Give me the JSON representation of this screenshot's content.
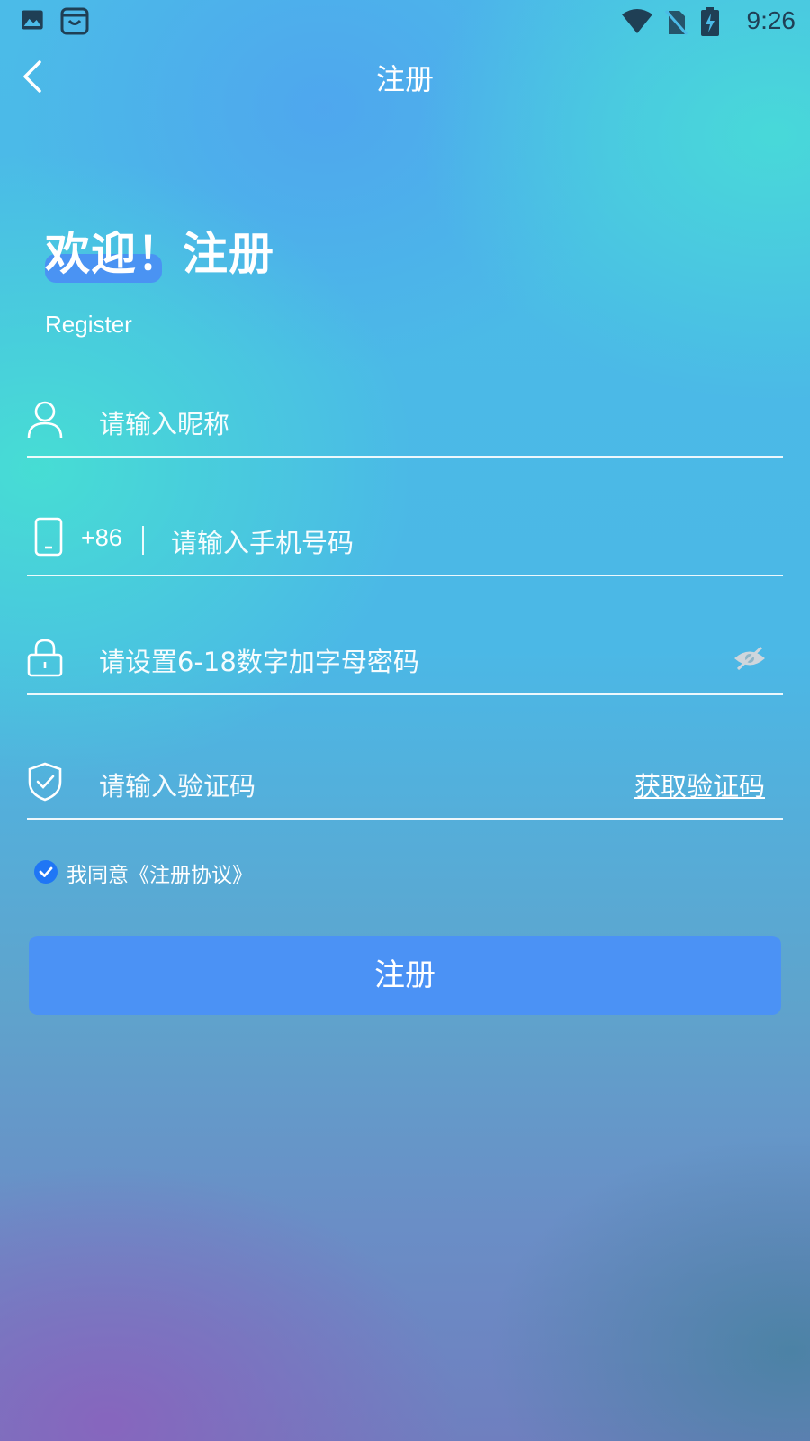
{
  "status_bar": {
    "time": "9:26"
  },
  "header": {
    "title": "注册"
  },
  "hero": {
    "title": "欢迎！注册",
    "subtitle": "Register"
  },
  "form": {
    "nickname_placeholder": "请输入昵称",
    "phone_prefix": "+86",
    "phone_placeholder": "请输入手机号码",
    "password_placeholder": "请设置6-18数字加字母密码",
    "code_placeholder": "请输入验证码",
    "get_code_label": "获取验证码"
  },
  "agreement": {
    "checked": true,
    "text": "我同意《注册协议》"
  },
  "submit_label": "注册",
  "colors": {
    "accent": "#4b92f5",
    "checkbox": "#1f76f5",
    "highlight": "#4a93f3"
  }
}
